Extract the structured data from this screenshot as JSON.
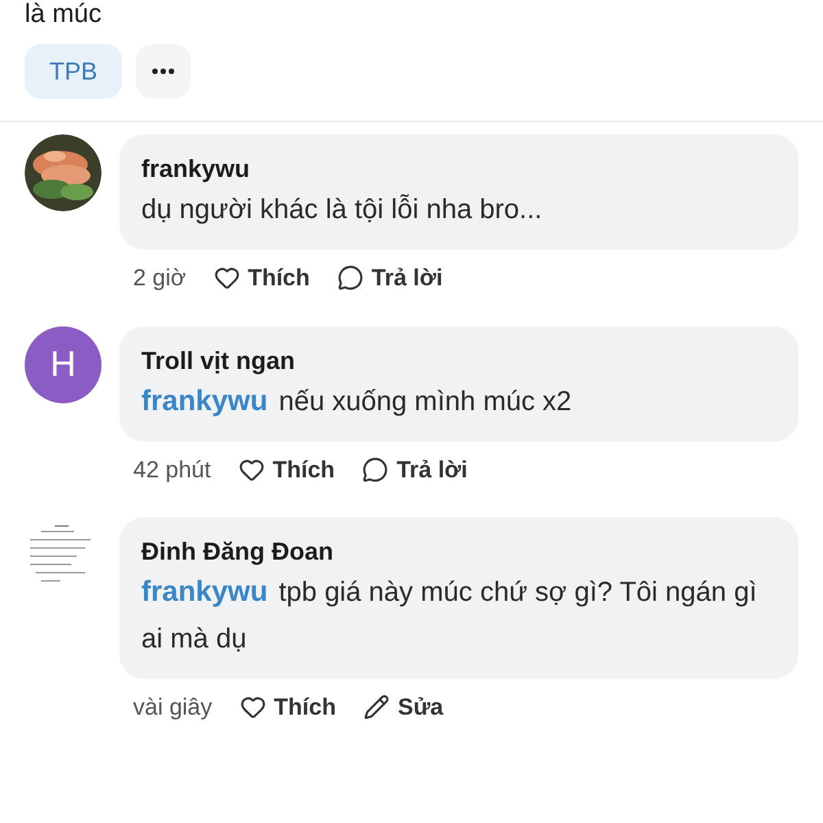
{
  "post": {
    "text": "là múc",
    "tags": [
      {
        "label": "TPB"
      }
    ]
  },
  "comments": [
    {
      "author": "frankywu",
      "avatar": {
        "kind": "picture"
      },
      "text": "dụ người khác là tội lỗi nha bro...",
      "time": "2 giờ",
      "actions": [
        {
          "kind": "like",
          "label": "Thích"
        },
        {
          "kind": "reply",
          "label": "Trả lời"
        }
      ]
    },
    {
      "author": "Troll vịt ngan",
      "avatar": {
        "kind": "letter",
        "letter": "H",
        "color": "#8a5cc4"
      },
      "mention": "frankywu",
      "text": "nếu xuống mình múc x2",
      "time": "42 phút",
      "actions": [
        {
          "kind": "like",
          "label": "Thích"
        },
        {
          "kind": "reply",
          "label": "Trả lời"
        }
      ]
    },
    {
      "author": "Đinh Đăng Đoan",
      "avatar": {
        "kind": "document"
      },
      "mention": "frankywu",
      "text": "tpb giá này múc chứ sợ gì? Tôi ngán gì ai mà dụ",
      "time": "vài giây",
      "actions": [
        {
          "kind": "like",
          "label": "Thích"
        },
        {
          "kind": "edit",
          "label": "Sửa"
        }
      ]
    }
  ]
}
